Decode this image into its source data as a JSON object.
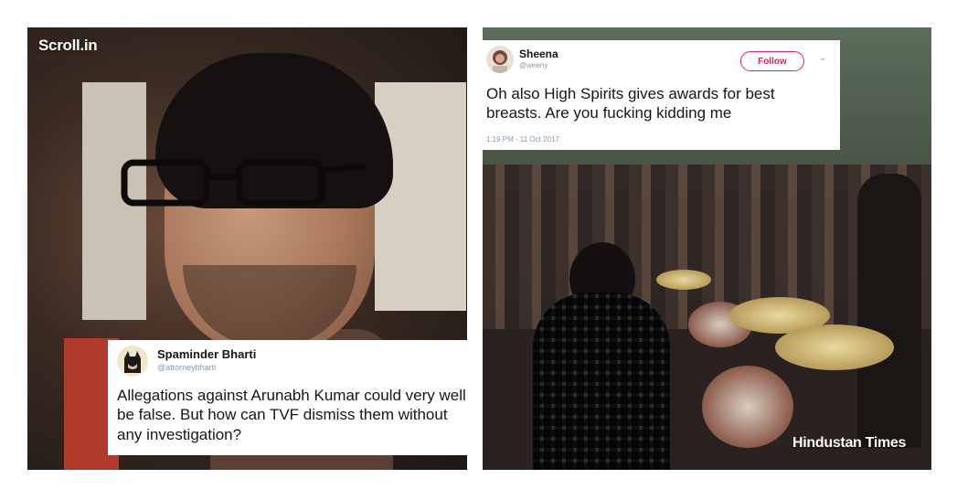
{
  "left_image": {
    "watermark": "Scroll.in",
    "tweet": {
      "name": "Spaminder Bharti",
      "handle": "@attorneybharti",
      "text": "Allegations against Arunabh Kumar could very well be false. But how can TVF dismiss them without any investigation?"
    }
  },
  "right_image": {
    "watermark": "Hindustan Times",
    "tweet": {
      "name": "Sheena",
      "handle": "@weeny",
      "follow_label": "Follow",
      "text": "Oh also High Spirits gives awards for best breasts. Are you fucking kidding me",
      "timestamp": "1:19 PM - 11 Oct 2017"
    }
  },
  "colors": {
    "follow_accent": "#e0245e",
    "handle_gray": "#8899a6"
  }
}
